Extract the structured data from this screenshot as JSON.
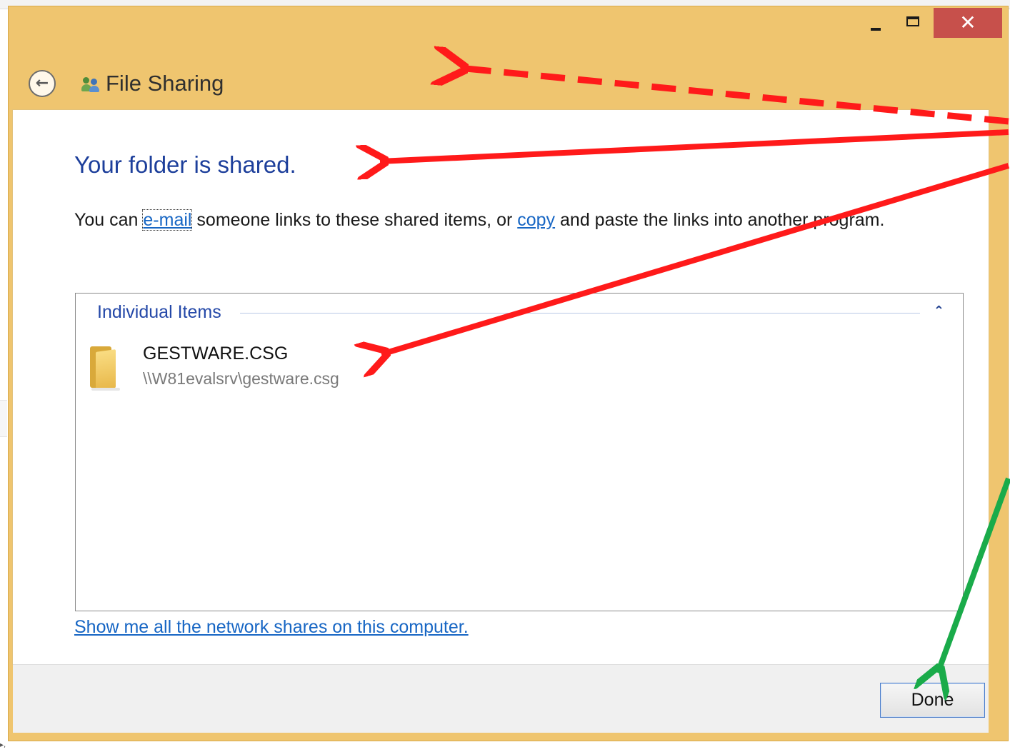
{
  "window": {
    "title": "File Sharing",
    "controls": {
      "minimize": "minimize-icon",
      "maximize": "maximize-icon",
      "close_glyph": "✕"
    },
    "accent_color": "#efc56f"
  },
  "content": {
    "heading": "Your folder is shared.",
    "description": {
      "part1": "You can ",
      "email_link": "e-mail",
      "part2": " someone links to these shared items, or ",
      "copy_link": "copy",
      "part3": " and paste the links into another program."
    },
    "group": {
      "header": "Individual Items",
      "collapse_glyph": "⌃",
      "items": [
        {
          "name": "GESTWARE.CSG",
          "path": "\\\\W81evalsrv\\gestware.csg",
          "icon": "folder-icon"
        }
      ]
    },
    "network_link": "Show me all the network shares on this computer."
  },
  "footer": {
    "done_label": "Done"
  },
  "annotation_colors": {
    "dashed_arrow": "#ff1a1a",
    "solid_arrow": "#ff1a1a",
    "green_arrow": "#1aab4a"
  }
}
